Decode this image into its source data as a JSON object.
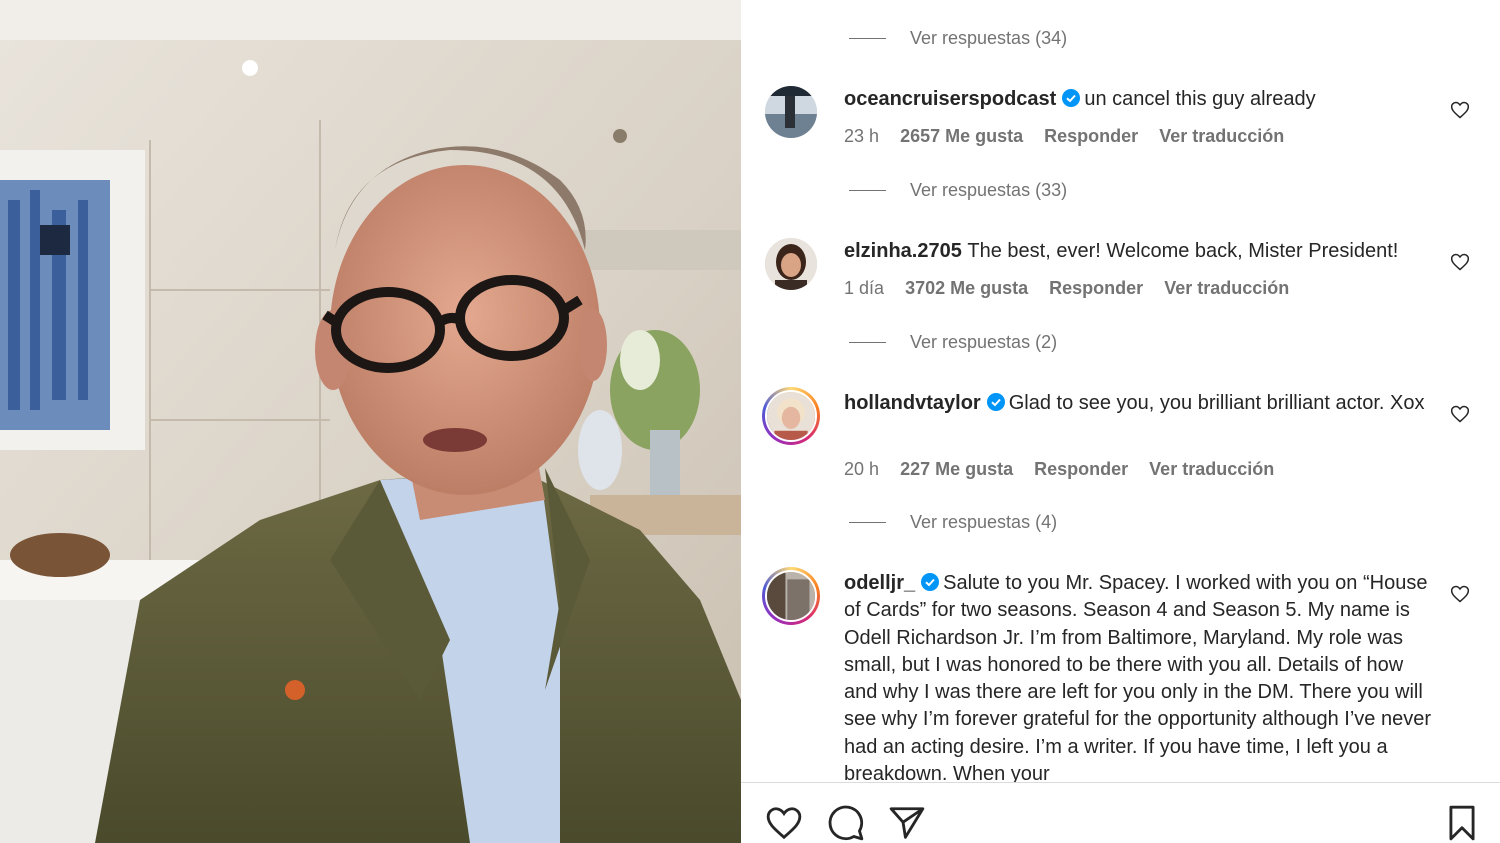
{
  "comments": [
    {
      "username": "oceancruiserspodcast",
      "verified": true,
      "text": "un cancel this guy already",
      "time": "23 h",
      "likes": "2657 Me gusta",
      "reply": "Responder",
      "translate": "Ver traducción"
    },
    {
      "username": "elzinha.2705",
      "verified": false,
      "text": "The best, ever! Welcome back, Mister President!",
      "time": "1 día",
      "likes": "3702 Me gusta",
      "reply": "Responder",
      "translate": "Ver traducción"
    },
    {
      "username": "hollandvtaylor",
      "verified": true,
      "text": "Glad to see you, you brilliant brilliant actor. Xox",
      "time": "20 h",
      "likes": "227 Me gusta",
      "reply": "Responder",
      "translate": "Ver traducción"
    },
    {
      "username": "odelljr_",
      "verified": true,
      "text": "Salute to you Mr. Spacey. I worked with you on “House of Cards” for two seasons. Season 4 and Season 5. My name is Odell Richardson Jr. I’m from Baltimore, Maryland. My role was small, but I was honored to be there with you all. Details of how and why I was there are left for you only in the DM. There you will see why I’m forever grateful for the opportunity although I’ve never had an acting desire. I’m a writer. If you have time, I left you a breakdown. When your"
    }
  ],
  "replies": [
    "Ver respuestas (34)",
    "Ver respuestas (33)",
    "Ver respuestas (2)",
    "Ver respuestas (4)"
  ],
  "icons": {
    "verified": "verified-badge-icon",
    "like": "heart-icon",
    "comment": "comment-icon",
    "share": "paper-plane-icon",
    "save": "bookmark-icon"
  },
  "colors": {
    "verified": "#0095f6",
    "secondary_text": "#737373",
    "primary_text": "#262626"
  }
}
